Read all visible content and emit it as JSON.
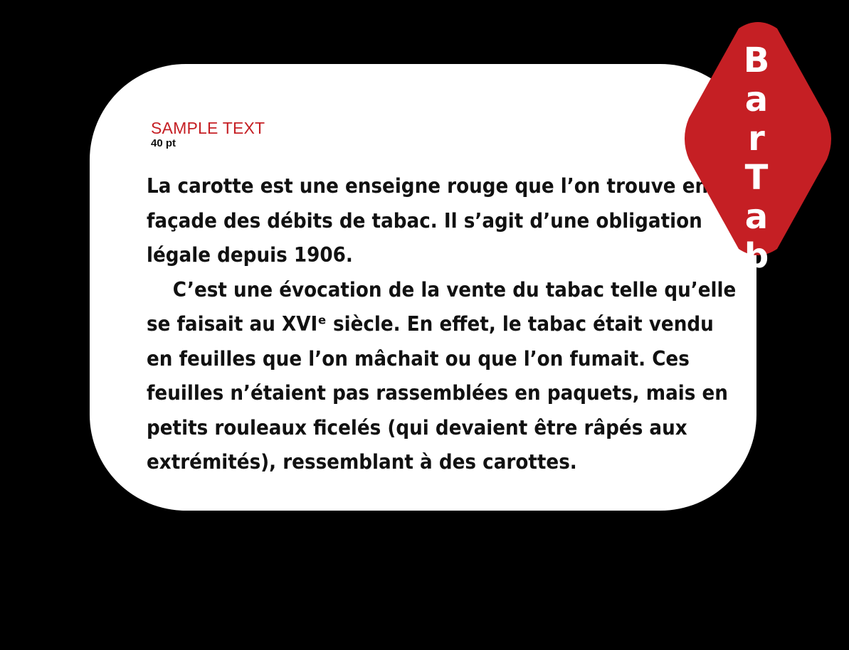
{
  "sample": {
    "label": "SAMPLE TEXT",
    "size": "40 pt"
  },
  "paragraph1": {
    "lines": [
      "La carotte est une enseigne rouge que l’on trouve en",
      "façade des débits de tabac. Il s’agit d’une obligation",
      "légale depuis 1906."
    ]
  },
  "paragraph2": {
    "lines": [
      "C’est une évocation de la vente du tabac telle qu’elle",
      "se faisait au XVIᵉ siècle. En effet, le tabac était vendu",
      "en feuilles que l’on mâchait ou que l’on fumait. Ces",
      "feuilles n’étaient pas rassemblées en paquets, mais en",
      "petits rouleaux ficelés (qui devaient être râpés aux",
      "extrémités), ressemblant à des carottes."
    ]
  },
  "logo": {
    "letters": [
      "B",
      "a",
      "r",
      "T",
      "a",
      "b"
    ],
    "color": "#c51f24"
  },
  "colors": {
    "background": "#000000",
    "card": "#ffffff",
    "accent": "#c51f24",
    "text": "#111111"
  }
}
